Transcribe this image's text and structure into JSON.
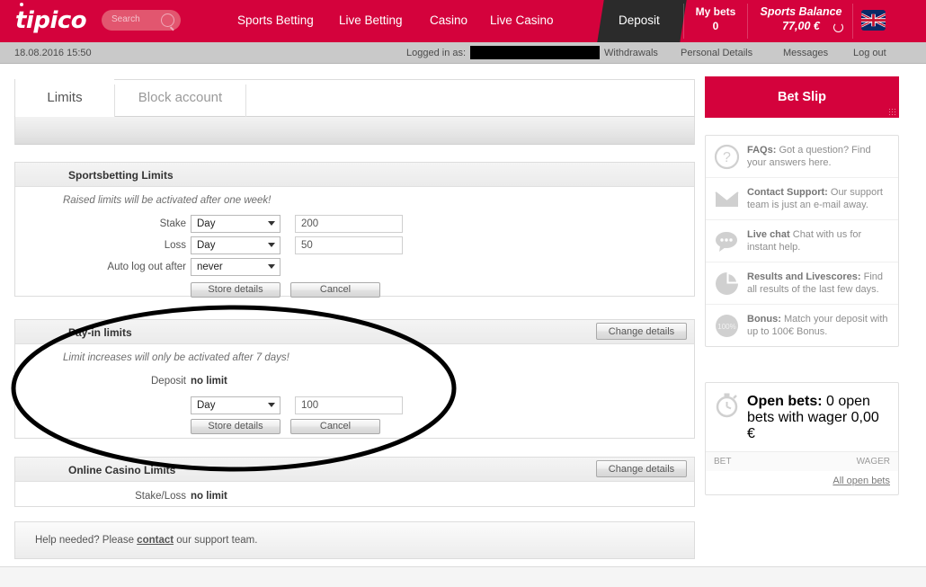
{
  "brand": {
    "logo": "tipico",
    "accent": "#d4023c",
    "dark": "#2b2b2b"
  },
  "topnav": {
    "search_placeholder": "Search",
    "links": [
      "Sports Betting",
      "Live Betting",
      "Casino",
      "Live Casino"
    ],
    "deposit": "Deposit",
    "my_bets_label": "My bets",
    "my_bets_count": "0",
    "balance_label": "Sports Balance",
    "balance_value": "77,00 €",
    "language_flag": "uk-flag-icon"
  },
  "infobar": {
    "datetime": "18.08.2016  15:50",
    "logged_in_as": "Logged in as:",
    "links": [
      "Withdrawals",
      "Personal Details",
      "Messages",
      "Log out"
    ]
  },
  "tabs": [
    {
      "label": "Limits",
      "active": true
    },
    {
      "label": "Block account",
      "active": false
    }
  ],
  "sportsbetting": {
    "title": "Sportsbetting Limits",
    "hint": "Raised limits will be activated after one week!",
    "rows": [
      {
        "label": "Stake",
        "period": "Day",
        "amount": "200"
      },
      {
        "label": "Loss",
        "period": "Day",
        "amount": "50"
      }
    ],
    "auto_logout_label": "Auto log out after",
    "auto_logout_value": "never",
    "store_label": "Store details",
    "cancel_label": "Cancel"
  },
  "payin": {
    "title": "Pay-in limits",
    "change_label": "Change details",
    "hint": "Limit increases will only be activated after 7 days!",
    "deposit_label": "Deposit",
    "deposit_value": "no limit",
    "period": "Day",
    "amount": "100",
    "store_label": "Store details",
    "cancel_label": "Cancel"
  },
  "casino": {
    "title": "Online Casino Limits",
    "change_label": "Change details",
    "row_label": "Stake/Loss",
    "row_value": "no limit"
  },
  "help": {
    "prefix": "Help needed? Please ",
    "link": "contact",
    "suffix": " our support team."
  },
  "sidebar": {
    "betslip": "Bet Slip",
    "items": [
      {
        "icon": "question-mark-icon",
        "bold": "FAQs:",
        "text": " Got a question? Find your answers here."
      },
      {
        "icon": "envelope-icon",
        "bold": "Contact Support:",
        "text": " Our support team is just an e-mail away."
      },
      {
        "icon": "chat-bubble-icon",
        "bold": "Live chat",
        "text": " Chat with us for instant help."
      },
      {
        "icon": "pie-chart-icon",
        "bold": "Results and Livescores:",
        "text": " Find all results of the last few days."
      },
      {
        "icon": "percent-100-icon",
        "bold": "Bonus:",
        "text": " Match your deposit with up to 100€ Bonus."
      }
    ],
    "open_bets": {
      "icon": "stopwatch-icon",
      "bold": "Open bets:",
      "text": " 0 open bets with wager 0,00 €",
      "col_bet": "BET",
      "col_wager": "WAGER",
      "all_link": "All open bets"
    }
  },
  "annotation": {
    "shape": "ellipse",
    "color": "#000000",
    "target": "pay-in-limits-section"
  }
}
